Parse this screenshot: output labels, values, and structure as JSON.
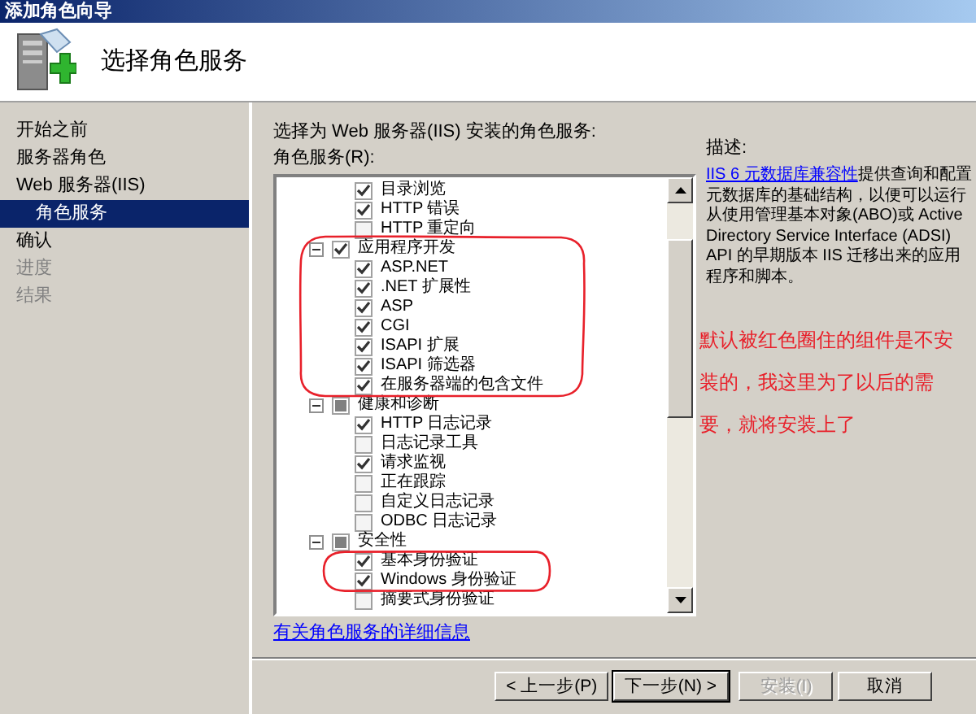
{
  "window": {
    "title": "添加角色向导"
  },
  "header": {
    "title": "选择角色服务"
  },
  "nav": [
    {
      "label": "开始之前",
      "selected": false,
      "disabled": false
    },
    {
      "label": "服务器角色",
      "selected": false,
      "disabled": false
    },
    {
      "label": "Web 服务器(IIS)",
      "selected": false,
      "disabled": false,
      "children": [
        {
          "label": "角色服务",
          "selected": true,
          "disabled": false
        }
      ]
    },
    {
      "label": "确认",
      "selected": false,
      "disabled": false
    },
    {
      "label": "进度",
      "selected": false,
      "disabled": true
    },
    {
      "label": "结果",
      "selected": false,
      "disabled": true
    }
  ],
  "prompt": "选择为 Web 服务器(IIS) 安装的角色服务:",
  "list_label": "角色服务(R):",
  "tree": [
    {
      "children": [
        {
          "label": "目录浏览",
          "checked": true
        },
        {
          "label": "HTTP 错误",
          "checked": true
        },
        {
          "label": "HTTP 重定向",
          "checked": false
        }
      ]
    },
    {
      "label": "应用程序开发",
      "expanded": true,
      "checked": true,
      "children": [
        {
          "label": "ASP.NET",
          "checked": true
        },
        {
          "label": ".NET 扩展性",
          "checked": true
        },
        {
          "label": "ASP",
          "checked": true
        },
        {
          "label": "CGI",
          "checked": true
        },
        {
          "label": "ISAPI 扩展",
          "checked": true
        },
        {
          "label": "ISAPI 筛选器",
          "checked": true
        },
        {
          "label": "在服务器端的包含文件",
          "checked": true
        }
      ]
    },
    {
      "label": "健康和诊断",
      "expanded": true,
      "partial": true,
      "children": [
        {
          "label": "HTTP 日志记录",
          "checked": true
        },
        {
          "label": "日志记录工具",
          "checked": false
        },
        {
          "label": "请求监视",
          "checked": true
        },
        {
          "label": "正在跟踪",
          "checked": false
        },
        {
          "label": "自定义日志记录",
          "checked": false
        },
        {
          "label": "ODBC 日志记录",
          "checked": false
        }
      ]
    },
    {
      "label": "安全性",
      "expanded": true,
      "partial": true,
      "children": [
        {
          "label": "基本身份验证",
          "checked": true
        },
        {
          "label": "Windows 身份验证",
          "checked": true
        },
        {
          "label": "摘要式身份验证",
          "checked": false
        }
      ]
    }
  ],
  "details_link": "有关角色服务的详细信息",
  "description": {
    "heading": "描述:",
    "link": "IIS 6 元数据库兼容性",
    "text": "提供查询和配置元数据库的基础结构，以便可以运行从使用管理基本对象(ABO)或 Active Directory Service Interface (ADSI) API 的早期版本 IIS 迁移出来的应用程序和脚本。"
  },
  "annotation": {
    "note": "默认被红色圈住的组件是不安装的，我这里为了以后的需要，就将安装上了"
  },
  "buttons": [
    {
      "label": "< 上一步(P)",
      "disabled": false,
      "default": false
    },
    {
      "label": "下一步(N) >",
      "disabled": false,
      "default": true
    },
    {
      "label": "安装(I)",
      "disabled": true,
      "default": false
    },
    {
      "label": "取消",
      "disabled": false,
      "default": false
    }
  ]
}
